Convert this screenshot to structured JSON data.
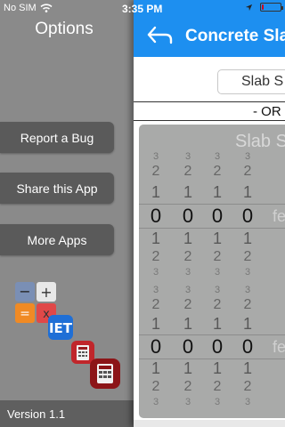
{
  "status_bar": {
    "carrier": "No SIM",
    "time": "3:35 PM",
    "battery_level": 0.1,
    "battery_color": "#d0021b"
  },
  "menu": {
    "title": "Options",
    "items": [
      {
        "label": "Report a Bug"
      },
      {
        "label": "Share this App"
      },
      {
        "label": "More Apps"
      }
    ],
    "version": "Version 1.1"
  },
  "nav": {
    "title": "Concrete Slab",
    "accent": "#1d8ff0"
  },
  "segment": {
    "label": "Slab S"
  },
  "or_label": "- OR",
  "picker": {
    "title": "Slab S",
    "unit_top": "fe",
    "unit_bottom": "fe",
    "top_digits": [
      "0",
      "0",
      "0",
      "0"
    ],
    "bottom_digits": [
      "0",
      "0",
      "0",
      "0"
    ],
    "rows_above": [
      "3",
      "2",
      "1"
    ],
    "rows_below": [
      "1",
      "2",
      "3"
    ]
  }
}
